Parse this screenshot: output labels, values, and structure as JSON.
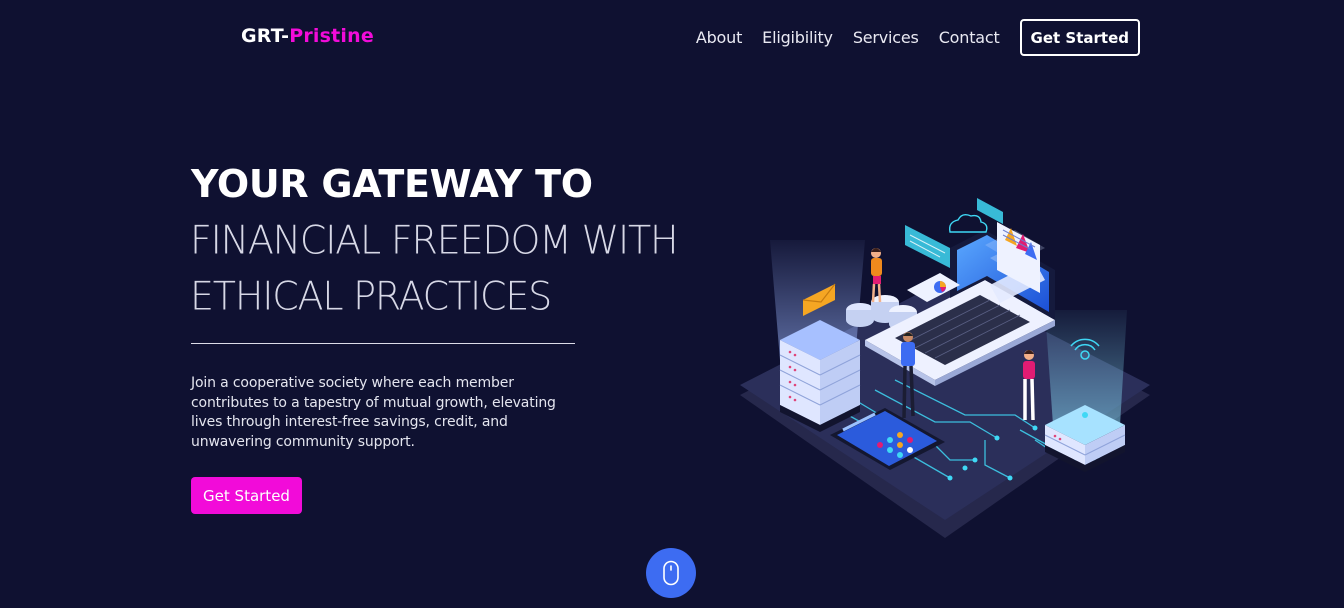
{
  "navbar": {
    "logo": {
      "prefix": "GRT-",
      "accent": "Pristine"
    },
    "links": [
      {
        "label": "About"
      },
      {
        "label": "Eligibility"
      },
      {
        "label": "Services"
      },
      {
        "label": "Contact"
      }
    ],
    "cta_label": "Get Started"
  },
  "hero": {
    "title_bold": "YOUR GATEWAY TO",
    "title_light_line1": "FINANCIAL FREEDOM WITH",
    "title_light_line2": "ETHICAL PRACTICES",
    "description": "Join a cooperative society where each member contributes to a tapestry of mutual growth, elevating lives through interest-free savings, credit, and unwavering community support.",
    "cta_label": "Get Started"
  },
  "scroll_indicator": {
    "icon": "mouse-icon"
  },
  "illustration": {
    "icon": "isometric-fintech-illustration"
  },
  "colors": {
    "background": "#0f1131",
    "accent": "#f20bd9",
    "scroll_button": "#3d6cf2",
    "text": "#ffffff"
  }
}
